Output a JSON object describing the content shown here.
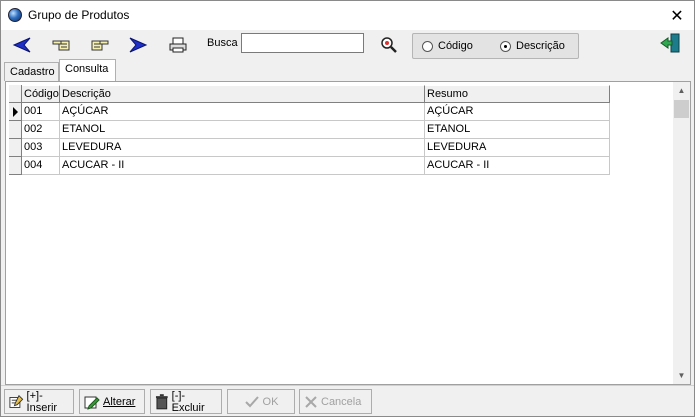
{
  "window": {
    "title": "Grupo de Produtos"
  },
  "toolbar": {
    "busca_label": "Busca",
    "busca_value": "",
    "radio_codigo": "Código",
    "radio_descricao": "Descrição",
    "selected": "Descrição"
  },
  "tabs": [
    {
      "label": "Cadastro",
      "active": false
    },
    {
      "label": "Consulta",
      "active": true
    }
  ],
  "grid": {
    "columns": [
      "Código",
      "Descrição",
      "Resumo"
    ],
    "rows": [
      {
        "codigo": "001",
        "descricao": "AÇÚCAR",
        "resumo": "AÇÚCAR"
      },
      {
        "codigo": "002",
        "descricao": "ETANOL",
        "resumo": "ETANOL"
      },
      {
        "codigo": "003",
        "descricao": "LEVEDURA",
        "resumo": "LEVEDURA"
      },
      {
        "codigo": "004",
        "descricao": "ACUCAR - II",
        "resumo": "ACUCAR - II"
      }
    ]
  },
  "bottom_buttons": {
    "inserir": "[+]-Inserir",
    "alterar": "Alterar",
    "excluir": "[-]-Excluir",
    "ok": "OK",
    "cancela": "Cancela"
  },
  "icons": {
    "first": "arrow-left-blue-icon",
    "prev": "hand-left-icon",
    "next": "hand-right-icon",
    "last": "arrow-right-blue-icon",
    "print": "printer-icon",
    "search": "magnifier-icon",
    "exit": "exit-door-icon"
  }
}
